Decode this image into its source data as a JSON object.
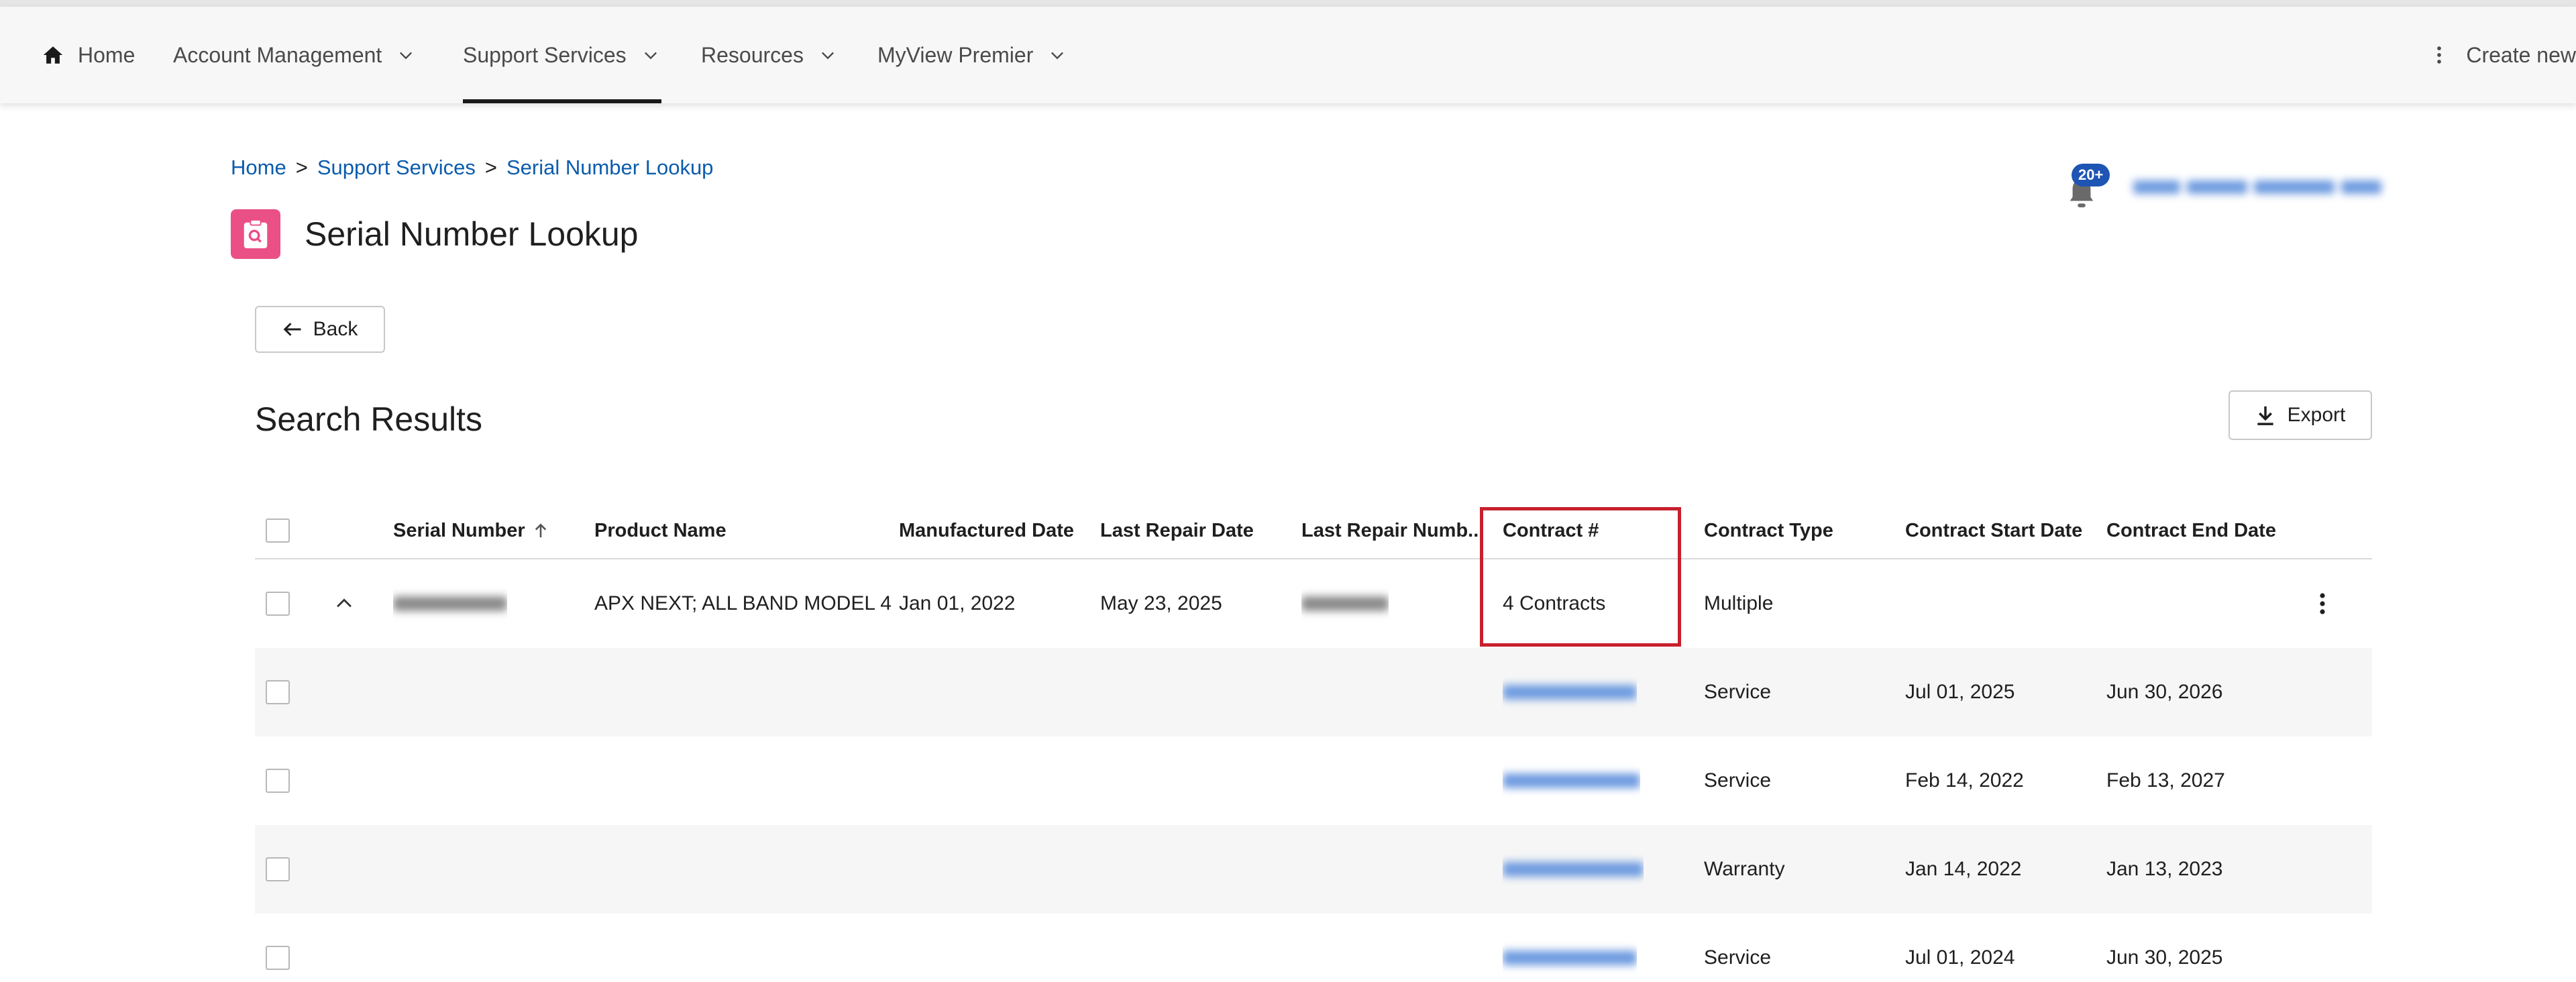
{
  "nav": {
    "home": "Home",
    "items": [
      {
        "label": "Account Management"
      },
      {
        "label": "Support Services"
      },
      {
        "label": "Resources"
      },
      {
        "label": "MyView Premier"
      }
    ],
    "create_new": "Create new"
  },
  "breadcrumb": {
    "home": "Home",
    "support": "Support Services",
    "current": "Serial Number Lookup",
    "separator": ">"
  },
  "page": {
    "title": "Serial Number Lookup",
    "notifications_badge": "20+"
  },
  "buttons": {
    "back": "Back",
    "export": "Export"
  },
  "results": {
    "title": "Search Results",
    "columns": [
      "Serial Number",
      "Product Name",
      "Manufactured Date",
      "Last Repair Date",
      "Last Repair Numb...",
      "Contract #",
      "Contract Type",
      "Contract Start Date",
      "Contract End Date"
    ],
    "main_row": {
      "product_name": "APX NEXT; ALL BAND MODEL 4",
      "manufactured_date": "Jan 01, 2022",
      "last_repair_date": "May 23, 2025",
      "contract": "4 Contracts",
      "contract_type": "Multiple"
    },
    "sub_rows": [
      {
        "contract_type": "Service",
        "start": "Jul 01, 2025",
        "end": "Jun 30, 2026"
      },
      {
        "contract_type": "Service",
        "start": "Feb 14, 2022",
        "end": "Feb 13, 2027"
      },
      {
        "contract_type": "Warranty",
        "start": "Jan 14, 2022",
        "end": "Jan 13, 2023"
      },
      {
        "contract_type": "Service",
        "start": "Jul 01, 2024",
        "end": "Jun 30, 2025"
      }
    ]
  },
  "colors": {
    "accent_link": "#0b5cad",
    "title_icon": "#ea4f86",
    "highlight": "#c8202e",
    "badge": "#1e55b3"
  }
}
